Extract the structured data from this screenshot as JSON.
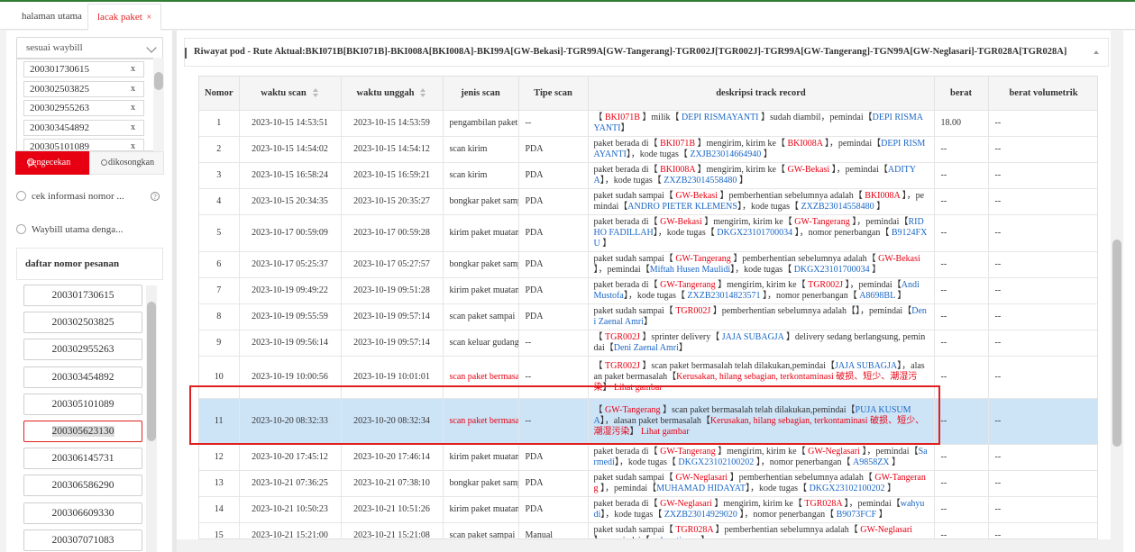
{
  "tabs": [
    {
      "label": "halaman utama"
    },
    {
      "label": "lacak paket",
      "close": "×"
    }
  ],
  "left": {
    "select_value": "sesuai waybill",
    "waybill_chips": [
      "200301730615",
      "200302503825",
      "200302955263",
      "200303454892",
      "200305101089"
    ],
    "chip_close": "x",
    "check_button": "pengecekan",
    "clear_button": "dikosongkan",
    "radio1": "cek informasi nomor ...",
    "radio1_help": "?",
    "radio2": "Waybill utama denga...",
    "list_title": "daftar nomor pesanan",
    "orders": [
      "200301730615",
      "200302503825",
      "200302955263",
      "200303454892",
      "200305101089",
      "200305623130",
      "200306145731",
      "200306586290",
      "200306609330",
      "200307071083"
    ],
    "selected_index": 5
  },
  "main": {
    "route_title": "Riwayat pod - Rute Aktual:BKI071B[BKI071B]-BKI008A[BKI008A]-BKI99A[GW-Bekasi]-TGR99A[GW-Tangerang]-TGR002J[TGR002J]-TGR99A[GW-Tangerang]-TGN99A[GW-Neglasari]-TGR028A[TGR028A]",
    "columns": [
      "Nomor",
      "waktu scan",
      "waktu unggah",
      "jenis scan",
      "Tipe scan",
      "deskripsi track record",
      "berat",
      "berat volumetrik"
    ],
    "rows": [
      {
        "no": "1",
        "scan": "2023-10-15 14:53:51",
        "upload": "2023-10-15 14:53:59",
        "type": "pengambilan paket",
        "tipe": "--",
        "berat": "18.00",
        "vol": "--",
        "desc": [
          [
            "k",
            "【 "
          ],
          [
            "r",
            "BKI071B"
          ],
          [
            "k",
            " 】milik【 "
          ],
          [
            "b",
            "DEPI RISMAYANTI"
          ],
          [
            "k",
            " 】sudah diambil，pemindai【"
          ],
          [
            "b",
            "DEPI RISMAYANTI"
          ],
          [
            "k",
            "】"
          ]
        ]
      },
      {
        "no": "2",
        "scan": "2023-10-15 14:54:02",
        "upload": "2023-10-15 14:54:12",
        "type": "scan kirim",
        "tipe": "PDA",
        "berat": "--",
        "vol": "--",
        "desc": [
          [
            "k",
            "paket berada di【 "
          ],
          [
            "r",
            "BKI071B"
          ],
          [
            "k",
            " 】mengirim, kirim ke【 "
          ],
          [
            "r",
            "BKI008A"
          ],
          [
            "k",
            " 】，pemindai【"
          ],
          [
            "b",
            "DEPI RISMAYANTI"
          ],
          [
            "k",
            "】，kode tugas【 "
          ],
          [
            "b",
            "ZXJB23014664940"
          ],
          [
            "k",
            " 】"
          ]
        ]
      },
      {
        "no": "3",
        "scan": "2023-10-15 16:58:24",
        "upload": "2023-10-15 16:59:21",
        "type": "scan kirim",
        "tipe": "PDA",
        "berat": "--",
        "vol": "--",
        "desc": [
          [
            "k",
            "paket berada di【 "
          ],
          [
            "r",
            "BKI008A"
          ],
          [
            "k",
            " 】mengirim, kirim ke【 "
          ],
          [
            "r",
            "GW-Bekasi"
          ],
          [
            "k",
            " 】，pemindai【"
          ],
          [
            "b",
            "ADITYA"
          ],
          [
            "k",
            "】，kode tugas【 "
          ],
          [
            "b",
            "ZXZB23014558480"
          ],
          [
            "k",
            " 】"
          ]
        ]
      },
      {
        "no": "4",
        "scan": "2023-10-15 20:34:35",
        "upload": "2023-10-15 20:35:27",
        "type": "bongkar paket sampai",
        "tipe": "PDA",
        "berat": "--",
        "vol": "--",
        "desc": [
          [
            "k",
            "paket sudah sampai【 "
          ],
          [
            "r",
            "GW-Bekasi"
          ],
          [
            "k",
            " 】pemberhentian sebelumnya adalah【 "
          ],
          [
            "r",
            "BKI008A"
          ],
          [
            "k",
            " 】，pemindai【"
          ],
          [
            "b",
            "ANDRO PIETER KLEMENS"
          ],
          [
            "k",
            "】，kode tugas【 "
          ],
          [
            "b",
            "ZXZB23014558480"
          ],
          [
            "k",
            " 】"
          ]
        ]
      },
      {
        "no": "5",
        "scan": "2023-10-17 00:59:09",
        "upload": "2023-10-17 00:59:28",
        "type": "kirim paket muatan",
        "tipe": "PDA",
        "berat": "--",
        "vol": "--",
        "desc": [
          [
            "k",
            "paket berada di【 "
          ],
          [
            "r",
            "GW-Bekasi"
          ],
          [
            "k",
            " 】mengirim, kirim ke【 "
          ],
          [
            "r",
            "GW-Tangerang"
          ],
          [
            "k",
            " 】，pemindai【"
          ],
          [
            "b",
            "RIDHO FADILLAH"
          ],
          [
            "k",
            "】，kode tugas【 "
          ],
          [
            "b",
            "DKGX23101700034"
          ],
          [
            "k",
            " 】，nomor penerbangan【 "
          ],
          [
            "b",
            "B9124FXU"
          ],
          [
            "k",
            " 】"
          ]
        ]
      },
      {
        "no": "6",
        "scan": "2023-10-17 05:25:37",
        "upload": "2023-10-17 05:27:57",
        "type": "bongkar paket sampai",
        "tipe": "PDA",
        "berat": "--",
        "vol": "--",
        "desc": [
          [
            "k",
            "paket sudah sampai【 "
          ],
          [
            "r",
            "GW-Tangerang"
          ],
          [
            "k",
            " 】pemberhentian sebelumnya adalah【 "
          ],
          [
            "r",
            "GW-Bekasi"
          ],
          [
            "k",
            " 】，pemindai【"
          ],
          [
            "b",
            "Miftah Husen Maulidi"
          ],
          [
            "k",
            "】，kode tugas【 "
          ],
          [
            "b",
            "DKGX23101700034"
          ],
          [
            "k",
            " 】"
          ]
        ]
      },
      {
        "no": "7",
        "scan": "2023-10-19 09:49:22",
        "upload": "2023-10-19 09:51:28",
        "type": "kirim paket muatan",
        "tipe": "PDA",
        "berat": "--",
        "vol": "--",
        "desc": [
          [
            "k",
            "paket berada di【 "
          ],
          [
            "r",
            "GW-Tangerang"
          ],
          [
            "k",
            " 】mengirim, kirim ke【 "
          ],
          [
            "r",
            "TGR002J"
          ],
          [
            "k",
            " 】，pemindai【"
          ],
          [
            "b",
            "Andi Mustofa"
          ],
          [
            "k",
            "】，kode tugas【 "
          ],
          [
            "b",
            "ZXZB23014823571"
          ],
          [
            "k",
            " 】，nomor penerbangan【 "
          ],
          [
            "b",
            "A8698BL"
          ],
          [
            "k",
            " 】"
          ]
        ]
      },
      {
        "no": "8",
        "scan": "2023-10-19 09:55:59",
        "upload": "2023-10-19 09:57:14",
        "type": "scan paket sampai",
        "tipe": "PDA",
        "berat": "--",
        "vol": "--",
        "desc": [
          [
            "k",
            "paket sudah sampai【 "
          ],
          [
            "r",
            "TGR002J"
          ],
          [
            "k",
            " 】pemberhentian sebelumnya adalah【】，pemindai【"
          ],
          [
            "b",
            "Deni Zaenal Amri"
          ],
          [
            "k",
            "】"
          ]
        ]
      },
      {
        "no": "9",
        "scan": "2023-10-19 09:56:14",
        "upload": "2023-10-19 09:57:14",
        "type": "scan keluar gudang",
        "tipe": "--",
        "berat": "--",
        "vol": "--",
        "desc": [
          [
            "k",
            "【 "
          ],
          [
            "r",
            "TGR002J"
          ],
          [
            "k",
            " 】sprinter delivery【 "
          ],
          [
            "b",
            "JAJA SUBAGJA"
          ],
          [
            "k",
            " 】delivery sedang berlangsung, pemindai【"
          ],
          [
            "b",
            "Deni Zaenal Amri"
          ],
          [
            "k",
            "】"
          ]
        ]
      },
      {
        "no": "10",
        "scan": "2023-10-19 10:00:56",
        "upload": "2023-10-19 10:01:01",
        "type": "scan paket bermasalah",
        "type_red": true,
        "tipe": "--",
        "berat": "--",
        "vol": "--",
        "desc": [
          [
            "k",
            "【 "
          ],
          [
            "r",
            "TGR002J"
          ],
          [
            "k",
            " 】scan paket bermasalah telah dilakukan,pemindai【"
          ],
          [
            "b",
            "JAJA SUBAGJA"
          ],
          [
            "k",
            "】，alasan paket bermasalah【"
          ],
          [
            "r",
            "Kerusakan, hilang sebagian, terkontaminasi 破损、短少、潮湿污染"
          ],
          [
            "k",
            "】 "
          ],
          [
            "r",
            "Lihat gambar"
          ]
        ]
      },
      {
        "no": "11",
        "scan": "2023-10-20 08:32:33",
        "upload": "2023-10-20 08:32:34",
        "type": "scan paket bermasalah",
        "type_red": true,
        "tipe": "--",
        "berat": "--",
        "vol": "--",
        "highlight": true,
        "desc": [
          [
            "k",
            "【 "
          ],
          [
            "r",
            "GW-Tangerang"
          ],
          [
            "k",
            " 】scan paket bermasalah telah dilakukan,pemindai【"
          ],
          [
            "b",
            "PUJA KUSUMA"
          ],
          [
            "k",
            "】，alasan paket bermasalah【"
          ],
          [
            "r",
            "Kerusakan, hilang sebagian, terkontaminasi 破损、短少、潮湿污染"
          ],
          [
            "k",
            "】 "
          ],
          [
            "r",
            "Lihat gambar"
          ]
        ]
      },
      {
        "no": "12",
        "scan": "2023-10-20 17:45:12",
        "upload": "2023-10-20 17:46:14",
        "type": "kirim paket muatan",
        "tipe": "PDA",
        "berat": "--",
        "vol": "--",
        "desc": [
          [
            "k",
            "paket berada di【 "
          ],
          [
            "r",
            "GW-Tangerang"
          ],
          [
            "k",
            " 】mengirim, kirim ke【 "
          ],
          [
            "r",
            "GW-Neglasari"
          ],
          [
            "k",
            " 】，pemindai【"
          ],
          [
            "b",
            "Sarmedi"
          ],
          [
            "k",
            "】，kode tugas【 "
          ],
          [
            "b",
            "DKGX23102100202"
          ],
          [
            "k",
            " 】，nomor penerbangan【 "
          ],
          [
            "b",
            "A9858ZX"
          ],
          [
            "k",
            " 】"
          ]
        ]
      },
      {
        "no": "13",
        "scan": "2023-10-21 07:36:25",
        "upload": "2023-10-21 07:38:10",
        "type": "bongkar paket sampai",
        "tipe": "PDA",
        "berat": "--",
        "vol": "--",
        "desc": [
          [
            "k",
            "paket sudah sampai【 "
          ],
          [
            "r",
            "GW-Neglasari"
          ],
          [
            "k",
            " 】pemberhentian sebelumnya adalah【 "
          ],
          [
            "r",
            "GW-Tangerang"
          ],
          [
            "k",
            " 】，pemindai【"
          ],
          [
            "b",
            "MUHAMAD HIDAYAT"
          ],
          [
            "k",
            "】，kode tugas【 "
          ],
          [
            "b",
            "DKGX23102100202"
          ],
          [
            "k",
            " 】"
          ]
        ]
      },
      {
        "no": "14",
        "scan": "2023-10-21 10:50:23",
        "upload": "2023-10-21 10:51:26",
        "type": "kirim paket muatan",
        "tipe": "PDA",
        "berat": "--",
        "vol": "--",
        "desc": [
          [
            "k",
            "paket berada di【 "
          ],
          [
            "r",
            "GW-Neglasari"
          ],
          [
            "k",
            " 】mengirim, kirim ke【 "
          ],
          [
            "r",
            "TGR028A"
          ],
          [
            "k",
            " 】，pemindai【"
          ],
          [
            "b",
            "wahyudi"
          ],
          [
            "k",
            "】，kode tugas【 "
          ],
          [
            "b",
            "ZXZB23014929020"
          ],
          [
            "k",
            " 】，nomor penerbangan【 "
          ],
          [
            "b",
            "B9073FCF"
          ],
          [
            "k",
            " 】"
          ]
        ]
      },
      {
        "no": "15",
        "scan": "2023-10-21 15:21:00",
        "upload": "2023-10-21 15:21:08",
        "type": "scan paket sampai",
        "tipe": "Manual",
        "berat": "--",
        "vol": "--",
        "desc": [
          [
            "k",
            "paket sudah sampai【 "
          ],
          [
            "r",
            "TGR028A"
          ],
          [
            "k",
            " 】pemberhentian sebelumnya adalah【 "
          ],
          [
            "r",
            "GW-Neglasari"
          ],
          [
            "k",
            " 】，pemindai【"
          ],
          [
            "b",
            "ande setiawan"
          ],
          [
            "k",
            "】"
          ]
        ]
      }
    ]
  },
  "colors": {
    "accent_red": "#e60012",
    "link_blue": "#1b67c5",
    "highlight_row": "#cde4f7"
  }
}
